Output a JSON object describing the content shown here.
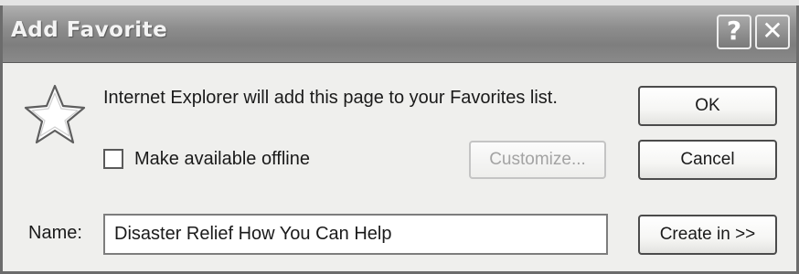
{
  "window": {
    "title": "Add Favorite",
    "help_glyph": "?",
    "close_glyph": "✕"
  },
  "icon": "star-icon",
  "message": "Internet Explorer will add this page to your Favorites list.",
  "offline": {
    "label": "Make available offline",
    "checked": false
  },
  "buttons": {
    "ok": "OK",
    "cancel": "Cancel",
    "customize": "Customize...",
    "create_in": "Create in >>"
  },
  "name": {
    "label": "Name:",
    "value": "Disaster Relief How You Can Help"
  }
}
